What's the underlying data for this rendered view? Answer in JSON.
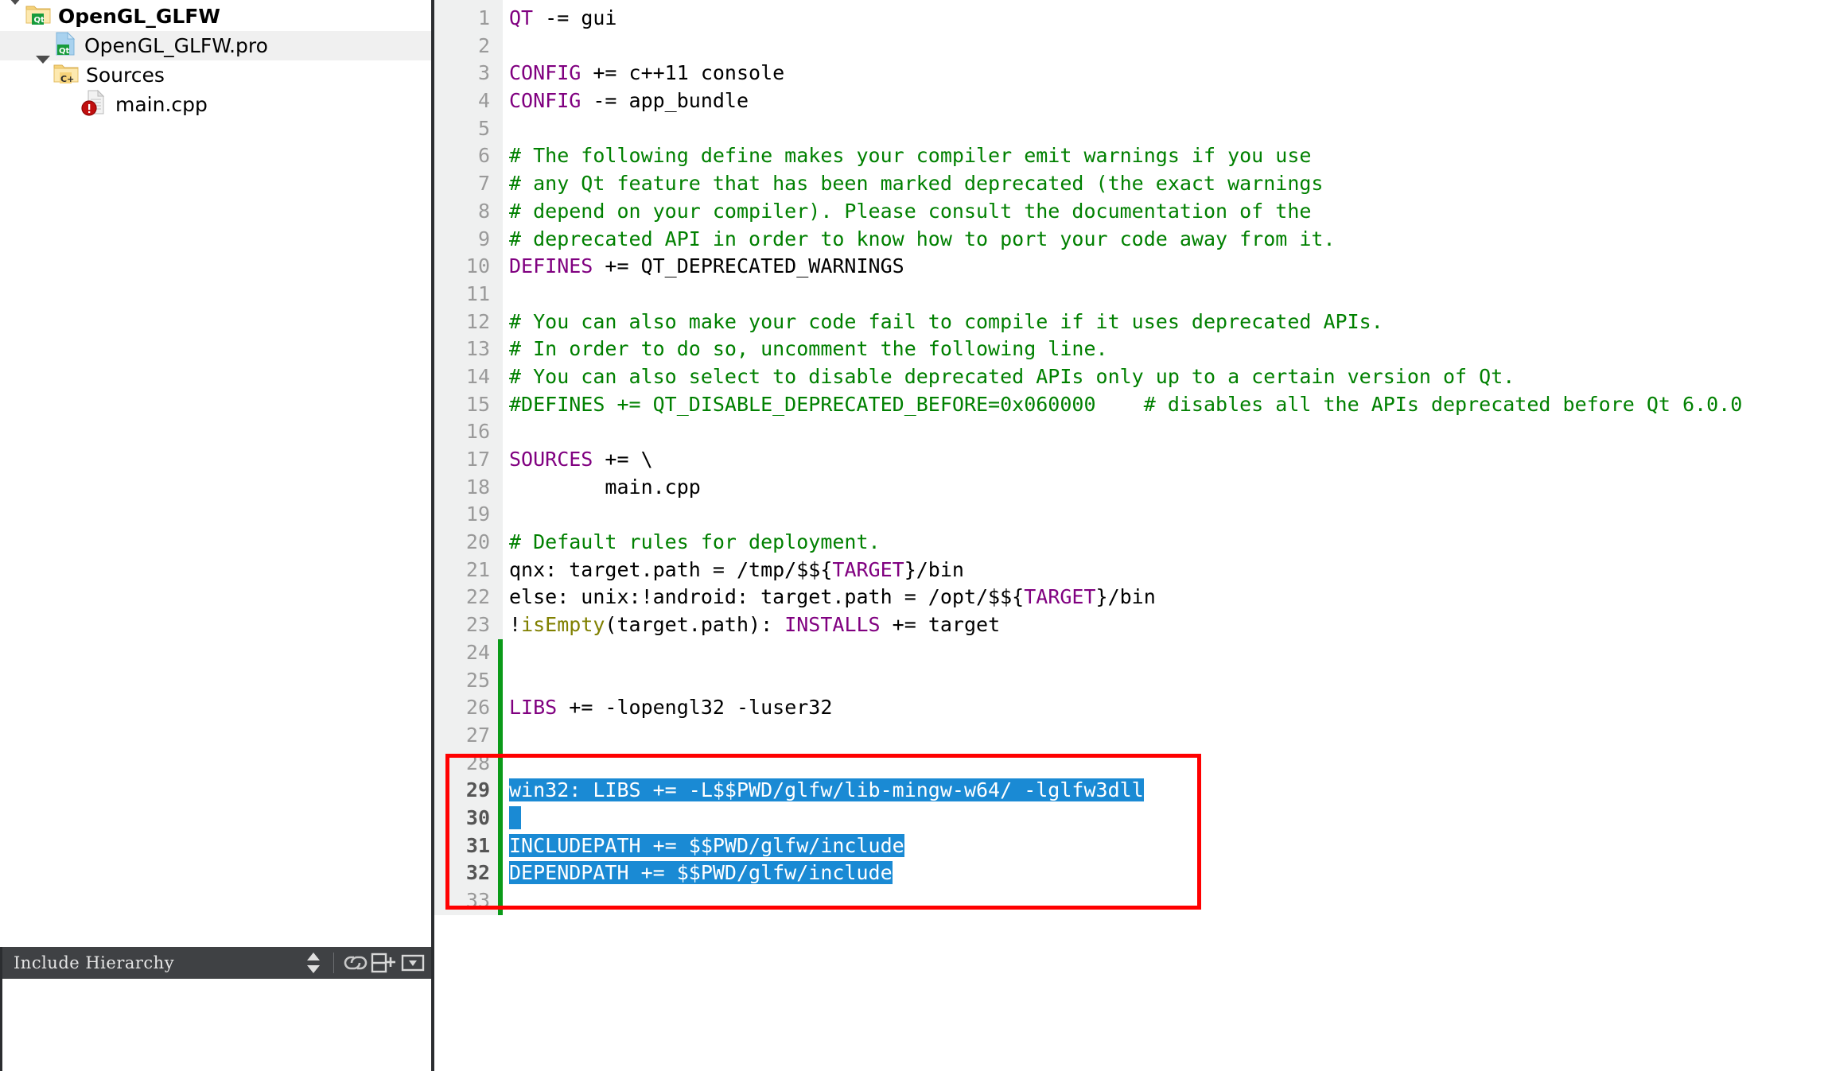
{
  "sidebar": {
    "project_tree": {
      "rows": [
        {
          "label": "OpenGL_GLFW",
          "icon": "qt-folder-icon",
          "depth": 0,
          "expander": "expanded",
          "bold": true,
          "selected": false
        },
        {
          "label": "OpenGL_GLFW.pro",
          "icon": "qt-profile-file-icon",
          "depth": 1,
          "expander": "none",
          "bold": false,
          "selected": true
        },
        {
          "label": "Sources",
          "icon": "cpp-folder-icon",
          "depth": 1,
          "expander": "expanded",
          "bold": false,
          "selected": false
        },
        {
          "label": "main.cpp",
          "icon": "cpp-file-error-icon",
          "depth": 2,
          "expander": "none",
          "bold": false,
          "selected": false
        }
      ]
    },
    "include_hierarchy": {
      "title": "Include Hierarchy",
      "icons": [
        {
          "name": "sort-updown-icon",
          "glyph": "spinner"
        },
        {
          "name": "link-icon",
          "glyph": "link"
        },
        {
          "name": "split-pane-add-icon",
          "glyph": "splitadd"
        },
        {
          "name": "dropdown-menu-icon",
          "glyph": "dropdown"
        }
      ]
    }
  },
  "editor": {
    "filename": "OpenGL_GLFW.pro",
    "first_line": 1,
    "selection_lines": [
      29,
      30,
      31,
      32
    ],
    "modified_lines_marker": {
      "from": 24,
      "to": 33,
      "color": "#0a9a18"
    },
    "annotation_box": {
      "color": "#ff0000",
      "covers_lines": [
        29,
        30,
        31,
        32
      ]
    },
    "colors": {
      "comment": "#008000",
      "keyword": "#800080",
      "function": "#808000",
      "selection_bg": "#1a8ad4",
      "selection_fg": "#ffffff",
      "gutter_bg": "#eff0f0",
      "text": "#000000"
    },
    "lines": [
      {
        "n": 1,
        "tokens": [
          {
            "t": "QT",
            "c": "kw"
          },
          {
            "t": " -= gui",
            "c": ""
          }
        ]
      },
      {
        "n": 2,
        "tokens": []
      },
      {
        "n": 3,
        "tokens": [
          {
            "t": "CONFIG",
            "c": "kw"
          },
          {
            "t": " += c++11 console",
            "c": ""
          }
        ]
      },
      {
        "n": 4,
        "tokens": [
          {
            "t": "CONFIG",
            "c": "kw"
          },
          {
            "t": " -= app_bundle",
            "c": ""
          }
        ]
      },
      {
        "n": 5,
        "tokens": []
      },
      {
        "n": 6,
        "tokens": [
          {
            "t": "# The following define makes your compiler emit warnings if you use",
            "c": "cmt"
          }
        ]
      },
      {
        "n": 7,
        "tokens": [
          {
            "t": "# any Qt feature that has been marked deprecated (the exact warnings",
            "c": "cmt"
          }
        ]
      },
      {
        "n": 8,
        "tokens": [
          {
            "t": "# depend on your compiler). Please consult the documentation of the",
            "c": "cmt"
          }
        ]
      },
      {
        "n": 9,
        "tokens": [
          {
            "t": "# deprecated API in order to know how to port your code away from it.",
            "c": "cmt"
          }
        ]
      },
      {
        "n": 10,
        "tokens": [
          {
            "t": "DEFINES",
            "c": "kw"
          },
          {
            "t": " += QT_DEPRECATED_WARNINGS",
            "c": ""
          }
        ]
      },
      {
        "n": 11,
        "tokens": []
      },
      {
        "n": 12,
        "tokens": [
          {
            "t": "# You can also make your code fail to compile if it uses deprecated APIs.",
            "c": "cmt"
          }
        ]
      },
      {
        "n": 13,
        "tokens": [
          {
            "t": "# In order to do so, uncomment the following line.",
            "c": "cmt"
          }
        ]
      },
      {
        "n": 14,
        "tokens": [
          {
            "t": "# You can also select to disable deprecated APIs only up to a certain version of Qt.",
            "c": "cmt"
          }
        ]
      },
      {
        "n": 15,
        "tokens": [
          {
            "t": "#DEFINES += QT_DISABLE_DEPRECATED_BEFORE=0x060000    # disables all the APIs deprecated before Qt 6.0.0",
            "c": "cmt"
          }
        ]
      },
      {
        "n": 16,
        "tokens": []
      },
      {
        "n": 17,
        "tokens": [
          {
            "t": "SOURCES",
            "c": "kw"
          },
          {
            "t": " += \\",
            "c": ""
          }
        ]
      },
      {
        "n": 18,
        "tokens": [
          {
            "t": "        main.cpp",
            "c": ""
          }
        ]
      },
      {
        "n": 19,
        "tokens": []
      },
      {
        "n": 20,
        "tokens": [
          {
            "t": "# Default rules for deployment.",
            "c": "cmt"
          }
        ]
      },
      {
        "n": 21,
        "tokens": [
          {
            "t": "qnx: target.path = /tmp/$${",
            "c": ""
          },
          {
            "t": "TARGET",
            "c": "kw"
          },
          {
            "t": "}/bin",
            "c": ""
          }
        ]
      },
      {
        "n": 22,
        "tokens": [
          {
            "t": "else: unix:!android: target.path = /opt/$${",
            "c": ""
          },
          {
            "t": "TARGET",
            "c": "kw"
          },
          {
            "t": "}/bin",
            "c": ""
          }
        ]
      },
      {
        "n": 23,
        "tokens": [
          {
            "t": "!",
            "c": ""
          },
          {
            "t": "isEmpty",
            "c": "fn"
          },
          {
            "t": "(target.path): ",
            "c": ""
          },
          {
            "t": "INSTALLS",
            "c": "kw"
          },
          {
            "t": " += target",
            "c": ""
          }
        ]
      },
      {
        "n": 24,
        "tokens": []
      },
      {
        "n": 25,
        "tokens": []
      },
      {
        "n": 26,
        "tokens": [
          {
            "t": "LIBS",
            "c": "kw"
          },
          {
            "t": " += -lopengl32 -luser32",
            "c": ""
          }
        ]
      },
      {
        "n": 27,
        "tokens": []
      },
      {
        "n": 28,
        "tokens": []
      },
      {
        "n": 29,
        "tokens": [
          {
            "t": "win32: LIBS += -L$$PWD/glfw/lib-mingw-w64/ -lglfw3dll",
            "c": "sel"
          }
        ]
      },
      {
        "n": 30,
        "tokens": [
          {
            "t": " ",
            "c": "sel"
          }
        ]
      },
      {
        "n": 31,
        "tokens": [
          {
            "t": "INCLUDEPATH += $$PWD/glfw/include",
            "c": "sel"
          }
        ]
      },
      {
        "n": 32,
        "tokens": [
          {
            "t": "DEPENDPATH += $$PWD/glfw/include",
            "c": "sel"
          }
        ]
      },
      {
        "n": 33,
        "tokens": []
      }
    ]
  }
}
